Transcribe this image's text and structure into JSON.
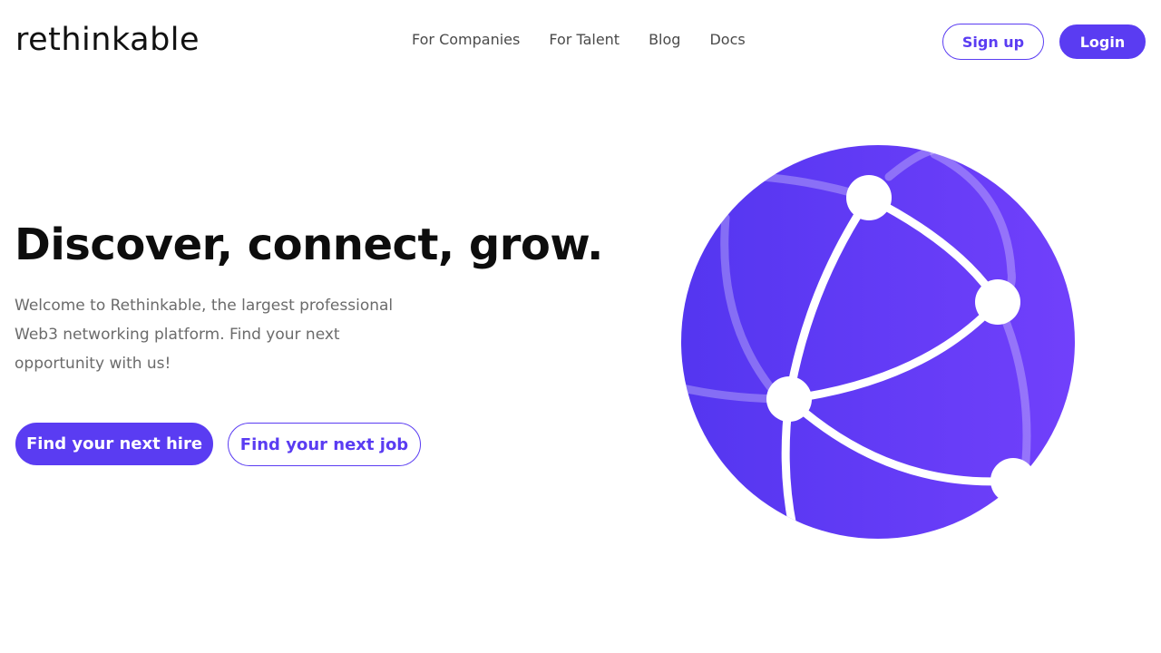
{
  "header": {
    "logo": "rethinkable",
    "nav": [
      "For Companies",
      "For Talent",
      "Blog",
      "Docs"
    ],
    "signup_label": "Sign up",
    "login_label": "Login"
  },
  "hero": {
    "title": "Discover, connect, grow.",
    "description": "Welcome to Rethinkable, the largest professional Web3 networking platform. Find your next opportunity with us!",
    "cta_hire": "Find your next hire",
    "cta_job": "Find your next job"
  },
  "colors": {
    "accent": "#5a3cf2",
    "globe_start": "#5436f0",
    "globe_end": "#7140fb"
  },
  "illustration": "network-globe-icon"
}
